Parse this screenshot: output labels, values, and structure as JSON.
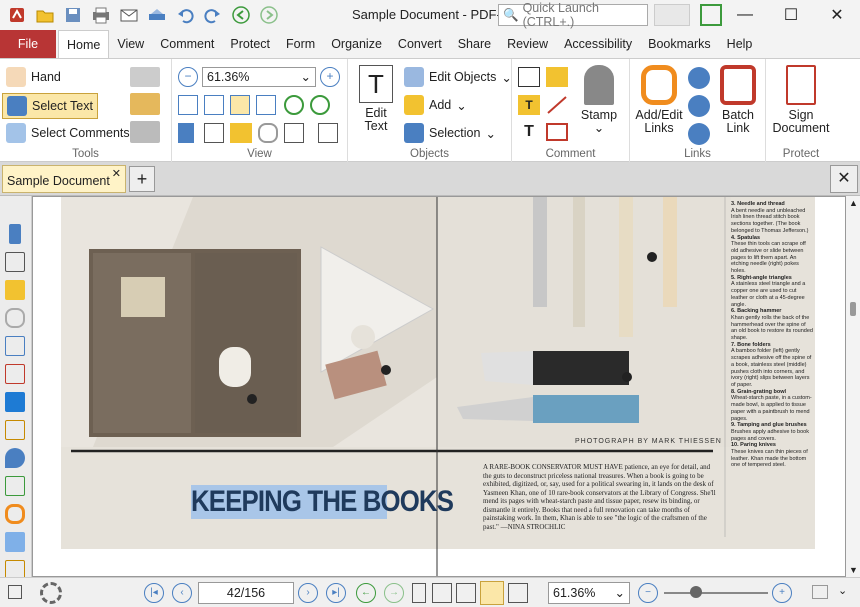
{
  "window": {
    "title": "Sample Document - PDF-...",
    "quick_launch": "Quick Launch (CTRL+.)"
  },
  "menu_tabs": [
    "File",
    "Home",
    "View",
    "Comment",
    "Protect",
    "Form",
    "Organize",
    "Convert",
    "Share",
    "Review",
    "Accessibility",
    "Bookmarks",
    "Help"
  ],
  "tools": {
    "hand": "Hand",
    "select_text": "Select Text",
    "select_comments": "Select Comments",
    "group": "Tools"
  },
  "view": {
    "zoom": "61.36%",
    "group": "View"
  },
  "objects": {
    "edit_text_1": "Edit",
    "edit_text_2": "Text",
    "edit_objects": "Edit Objects",
    "add": "Add",
    "selection": "Selection",
    "group": "Objects"
  },
  "comment": {
    "stamp": "Stamp",
    "group": "Comment"
  },
  "links": {
    "add_edit_1": "Add/Edit",
    "add_edit_2": "Links",
    "batch_1": "Batch",
    "batch_2": "Link",
    "group": "Links"
  },
  "protect": {
    "sign_1": "Sign",
    "sign_2": "Document",
    "group": "Protect"
  },
  "doc_tab": "Sample Document",
  "page": {
    "photo_credit": "PHOTOGRAPH BY MARK THIESSEN",
    "heading": "KEEPING THE BOOKS",
    "body": "A RARE-BOOK CONSERVATOR MUST HAVE patience, an eye for detail, and the guts to deconstruct priceless national treasures. When a book is going to be exhibited, digitized, or, say, used for a political swearing in, it lands on the desk of Yasmeen Khan, one of 10 rare-book conservators at the Library of Congress. She'll mend its pages with wheat-starch paste and tissue paper, resew its binding, or dismantle it entirely. Books that need a full renovation can take months of painstaking work. In them, Khan is able to see \"the logic of the craftsmen of the past.\" —NINA STROCHLIC",
    "sidebar_items": [
      {
        "title": "3. Needle and thread",
        "text": "A bent needle and unbleached Irish linen thread stitch book sections together. (The book belonged to Thomas Jefferson.)"
      },
      {
        "title": "4. Spatulas",
        "text": "These thin tools can scrape off old adhesive or slide between pages to lift them apart. An etching needle (right) pokes holes."
      },
      {
        "title": "5. Right-angle triangles",
        "text": "A stainless steel triangle and a copper one are used to cut leather or cloth at a 45-degree angle."
      },
      {
        "title": "6. Backing hammer",
        "text": "Khan gently rolls the back of the hammerhead over the spine of an old book to restore its rounded shape."
      },
      {
        "title": "7. Bone folders",
        "text": "A bamboo folder (left) gently scrapes adhesive off the spine of a book, stainless steel (middle) pushes cloth into corners, and ivory (right) slips between layers of paper."
      },
      {
        "title": "8. Grain-grating bowl",
        "text": "Wheat-starch paste, in a custom-made bowl, is applied to tissue paper with a paintbrush to mend pages."
      },
      {
        "title": "9. Tamping and glue brushes",
        "text": "Brushes apply adhesive to book pages and covers."
      },
      {
        "title": "10. Paring knives",
        "text": "These knives can thin pieces of leather. Khan made the bottom one of tempered steel."
      }
    ]
  },
  "status": {
    "page_input": "42",
    "page_total": "/156",
    "zoom": "61.36%"
  }
}
